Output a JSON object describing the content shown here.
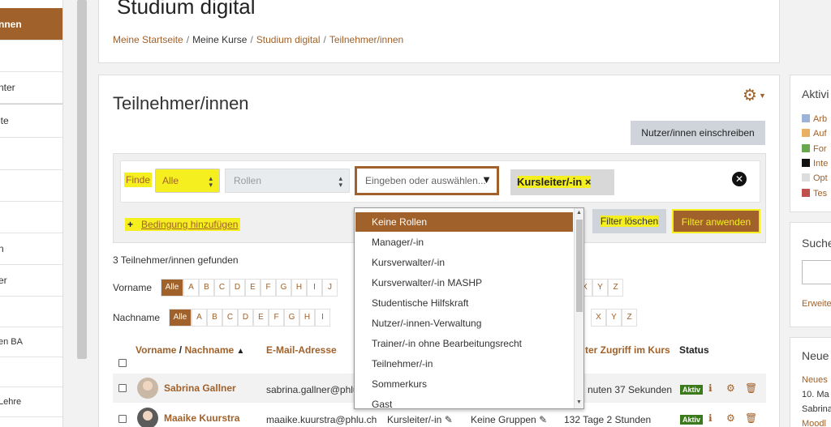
{
  "left_nav": {
    "items": [
      {
        "label": "nnen",
        "active": true
      },
      {
        "label": ""
      },
      {
        "label": "nter"
      },
      {
        "label": "ite"
      },
      {
        "label": ""
      },
      {
        "label": ""
      },
      {
        "label": "n"
      },
      {
        "label": "er"
      },
      {
        "label": ""
      },
      {
        "label": "en BA"
      },
      {
        "label": "l"
      },
      {
        "label": "Lehre"
      }
    ]
  },
  "header": {
    "course_title": "Studium digital",
    "breadcrumb": [
      "Meine Startseite",
      "Meine Kurse",
      "Studium digital",
      "Teilnehmer/innen"
    ]
  },
  "main": {
    "page_title": "Teilnehmer/innen",
    "enrol_button": "Nutzer/innen einschreiben",
    "filter": {
      "finde_label": "Finde",
      "match_value": "Alle",
      "roles_placeholder": "Rollen",
      "type_placeholder": "Eingeben oder auswählen...",
      "selected_tag": "Kursleiter/-in",
      "add_condition": "Bedingung hinzufügen",
      "clear_button": "Filter löschen",
      "apply_button": "Filter anwenden"
    },
    "found_text": "3 Teilnehmer/innen gefunden",
    "firstname_label": "Vorname",
    "lastname_label": "Nachname",
    "all_label": "Alle",
    "letters_firstname_left": [
      "A",
      "B",
      "C",
      "D",
      "E",
      "F",
      "G",
      "H",
      "I",
      "J"
    ],
    "letters_firstname_right": [
      "X",
      "Y",
      "Z"
    ],
    "letters_lastname_left": [
      "A",
      "B",
      "C",
      "D",
      "E",
      "F",
      "G",
      "H",
      "I"
    ],
    "letters_lastname_right": [
      "X",
      "Y",
      "Z"
    ],
    "table": {
      "col_name_first": "Vorname",
      "col_name_sep": " / ",
      "col_name_last": "Nachname",
      "sort_arrow": "▲",
      "col_email": "E-Mail-Adresse",
      "col_access": "ter Zugriff im Kurs",
      "col_status": "Status",
      "rows": [
        {
          "name": "Sabrina Gallner",
          "email": "sabrina.gallner@phlu",
          "role": "",
          "groups": "",
          "access": "nuten 37 Sekunden",
          "status": "Aktiv"
        },
        {
          "name": "Maaike Kuurstra",
          "email": "maaike.kuurstra@phlu.ch",
          "role": "Kursleiter/-in",
          "groups": "Keine Gruppen",
          "access": "132 Tage 2 Stunden",
          "status": "Aktiv"
        }
      ]
    }
  },
  "dropdown": {
    "options": [
      "Keine Rollen",
      "Manager/-in",
      "Kursverwalter/-in",
      "Kursverwalter/-in MASHP",
      "Studentische Hilfskraft",
      "Nutzer/-innen-Verwaltung",
      "Trainer/-in ohne Bearbeitungsrecht",
      "Teilnehmer/-in",
      "Sommerkurs",
      "Gast"
    ],
    "selected_index": 0
  },
  "right": {
    "activities_title": "Aktivi",
    "activities": [
      "Arb",
      "Auf",
      "For",
      "Inte",
      "Opt",
      "Tes"
    ],
    "search_title": "Suche",
    "search_link": "Erweite",
    "news_title": "Neue",
    "news_lines": [
      "Neues",
      "10. Ma",
      "Sabrina",
      "Moodl"
    ]
  },
  "colors": {
    "accent": "#a0612a",
    "highlight": "#f5ef1f",
    "active_badge": "#3a7a1a"
  }
}
